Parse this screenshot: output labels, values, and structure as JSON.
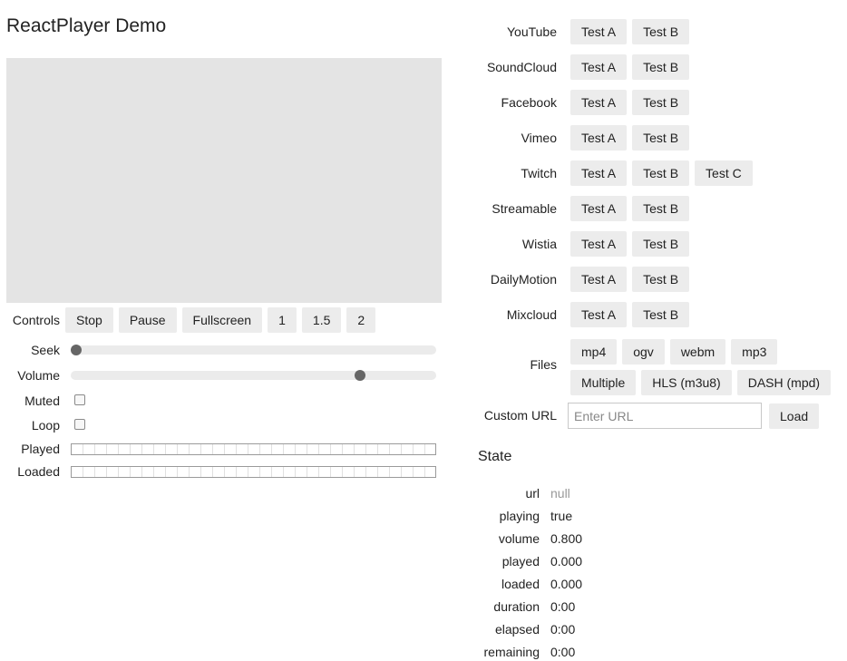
{
  "page": {
    "title": "ReactPlayer Demo"
  },
  "controls": {
    "label": "Controls",
    "buttons": [
      "Stop",
      "Pause",
      "Fullscreen",
      "1",
      "1.5",
      "2"
    ],
    "seek_label": "Seek",
    "seek_value": 0,
    "volume_label": "Volume",
    "volume_value": 0.8,
    "muted_label": "Muted",
    "muted_checked": false,
    "loop_label": "Loop",
    "loop_checked": false,
    "played_label": "Played",
    "played_value": 0,
    "loaded_label": "Loaded",
    "loaded_value": 0
  },
  "sources": [
    {
      "name": "YouTube",
      "tests": [
        "Test A",
        "Test B"
      ]
    },
    {
      "name": "SoundCloud",
      "tests": [
        "Test A",
        "Test B"
      ]
    },
    {
      "name": "Facebook",
      "tests": [
        "Test A",
        "Test B"
      ]
    },
    {
      "name": "Vimeo",
      "tests": [
        "Test A",
        "Test B"
      ]
    },
    {
      "name": "Twitch",
      "tests": [
        "Test A",
        "Test B",
        "Test C"
      ]
    },
    {
      "name": "Streamable",
      "tests": [
        "Test A",
        "Test B"
      ]
    },
    {
      "name": "Wistia",
      "tests": [
        "Test A",
        "Test B"
      ]
    },
    {
      "name": "DailyMotion",
      "tests": [
        "Test A",
        "Test B"
      ]
    },
    {
      "name": "Mixcloud",
      "tests": [
        "Test A",
        "Test B"
      ]
    }
  ],
  "files": {
    "label": "Files",
    "buttons": [
      "mp4",
      "ogv",
      "webm",
      "mp3",
      "Multiple",
      "HLS (m3u8)",
      "DASH (mpd)"
    ]
  },
  "custom_url": {
    "label": "Custom URL",
    "placeholder": "Enter URL",
    "value": "",
    "load_label": "Load"
  },
  "state": {
    "title": "State",
    "rows": [
      {
        "key": "url",
        "value": "null"
      },
      {
        "key": "playing",
        "value": "true"
      },
      {
        "key": "volume",
        "value": "0.800"
      },
      {
        "key": "played",
        "value": "0.000"
      },
      {
        "key": "loaded",
        "value": "0.000"
      },
      {
        "key": "duration",
        "value": "0:00"
      },
      {
        "key": "elapsed",
        "value": "0:00"
      },
      {
        "key": "remaining",
        "value": "0:00"
      }
    ]
  }
}
